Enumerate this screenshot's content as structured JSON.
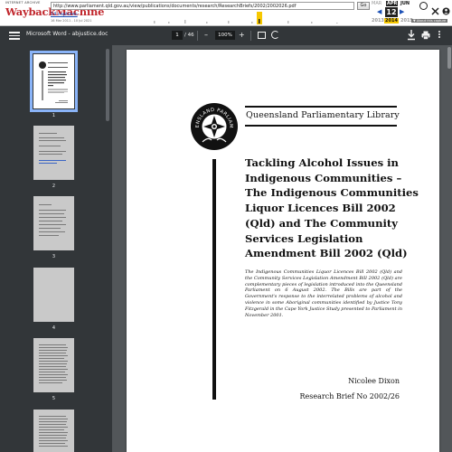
{
  "wayback": {
    "logo_top": "INTERNET ARCHIVE",
    "logo_word": "WaybackMachine",
    "url": "http://www.parliament.qld.gov.au/view/publications/documents/research/ResearchBriefs/2002/2002026.pdf",
    "go_label": "Go",
    "captures_label": "14 captures",
    "date_range": "16 Mar 2011 - 10 Jul 2021",
    "months": {
      "prev": "MAR",
      "current": "APR",
      "next": "JUN"
    },
    "day": "12",
    "years": {
      "prev": "2013",
      "current": "2014",
      "next": "2015"
    },
    "about_label": "▼ About this capture",
    "accent": "#f7c800"
  },
  "toolbar": {
    "title": "Microsoft Word - abjustice.doc",
    "page_current": "1",
    "page_total": "/ 46",
    "zoom": "100%",
    "zoom_minus": "–",
    "zoom_plus": "+",
    "icons": [
      "menu-icon",
      "fit-page-icon",
      "rotate-icon",
      "download-icon",
      "print-icon",
      "more-icon"
    ],
    "bg_color": "#323639"
  },
  "sidebar": {
    "thumbnails": [
      {
        "label": "1",
        "selected": true
      },
      {
        "label": "2",
        "selected": false
      },
      {
        "label": "3",
        "selected": false
      },
      {
        "label": "4",
        "selected": false
      },
      {
        "label": "5",
        "selected": false
      }
    ],
    "selected_color": "#8ab4f8"
  },
  "document": {
    "library": "Queensland Parliamentary Library",
    "crest_text": "QUEENSLAND PARLIAMENT",
    "title": "Tackling Alcohol Issues in Indigenous Communities – The Indigenous Communities Liquor Licences Bill 2002 (Qld) and The Community Services Legislation Amendment Bill 2002 (Qld)",
    "abstract": "The Indigenous Communities Liquor Licences Bill 2002 (Qld) and the Community Services Legislation Amendment Bill 2002 (Qld) are complementary pieces of legislation introduced into the Queensland Parliament on 6 August 2002. The Bills are part of the Government's response to the interrelated problems of alcohol and violence in some Aboriginal communities identified by Justice Tony Fitzgerald in the Cape York Justice Study presented to Parliament in November 2001.",
    "author": "Nicolee Dixon",
    "brief": "Research Brief No 2002/26"
  }
}
